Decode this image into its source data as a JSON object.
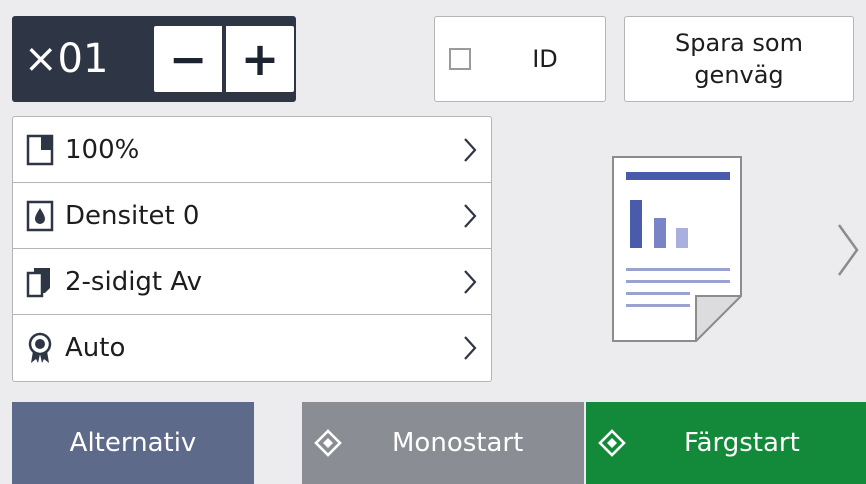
{
  "copies": {
    "count": "×01",
    "decrease_label": "−",
    "increase_label": "+"
  },
  "id_copy": {
    "label": "ID",
    "checked": false
  },
  "save_shortcut": {
    "line1": "Spara som",
    "line2": "genväg"
  },
  "settings": [
    {
      "icon": "page-ratio-icon",
      "label": "100%"
    },
    {
      "icon": "density-drop-icon",
      "label": "Densitet 0"
    },
    {
      "icon": "two-sided-icon",
      "label": "2-sidigt Av"
    },
    {
      "icon": "quality-ribbon-icon",
      "label": "Auto"
    }
  ],
  "bottom": {
    "options_label": "Alternativ",
    "mono_start_label": "Monostart",
    "color_start_label": "Färgstart"
  },
  "colors": {
    "panel_dark": "#2e3645",
    "options": "#5e6a8a",
    "mono": "#8a8d94",
    "color_start": "#138a3a",
    "preview_accent": "#4a5bab"
  }
}
